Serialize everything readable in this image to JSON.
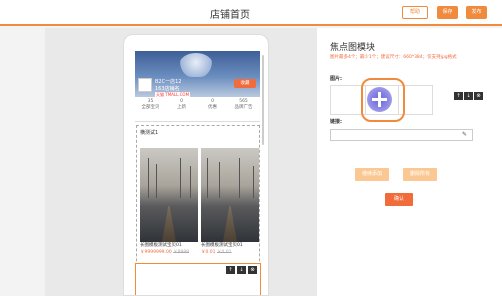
{
  "header": {
    "title": "店铺首页",
    "help_label": "帮助",
    "save_label": "保存",
    "publish_label": "发布"
  },
  "preview": {
    "shop_line1": "B2C一店12",
    "shop_line2": "163店铺名",
    "shop_tag": "天猫 TMALL.COM",
    "collect_label": "收藏",
    "stats": [
      {
        "value": "35",
        "label": "全部宝贝"
      },
      {
        "value": "0",
        "label": "上新"
      },
      {
        "value": "0",
        "label": "优惠"
      },
      {
        "value": "565",
        "label": "品牌广告"
      }
    ],
    "section_label": "横测试1",
    "products": [
      {
        "name": "长图模板测试宝贝01",
        "price": "￥9999999.00",
        "old_price": "￥9999"
      },
      {
        "name": "长图模板测试宝贝01",
        "price": "￥0.01",
        "old_price": "￥0.01"
      }
    ]
  },
  "panel": {
    "title": "焦点图模块",
    "description": "图片最多4个；最少1个；建议尺寸：660*384；仅支持jpg格式",
    "image_label": "图片:",
    "link_label": "链接:",
    "link_value": "",
    "add_button": "继续添加",
    "delete_button": "删除所有",
    "confirm_button": "确认"
  },
  "icons": {
    "up": "↑",
    "down": "↓",
    "close": "⊗",
    "edit": "✎"
  }
}
